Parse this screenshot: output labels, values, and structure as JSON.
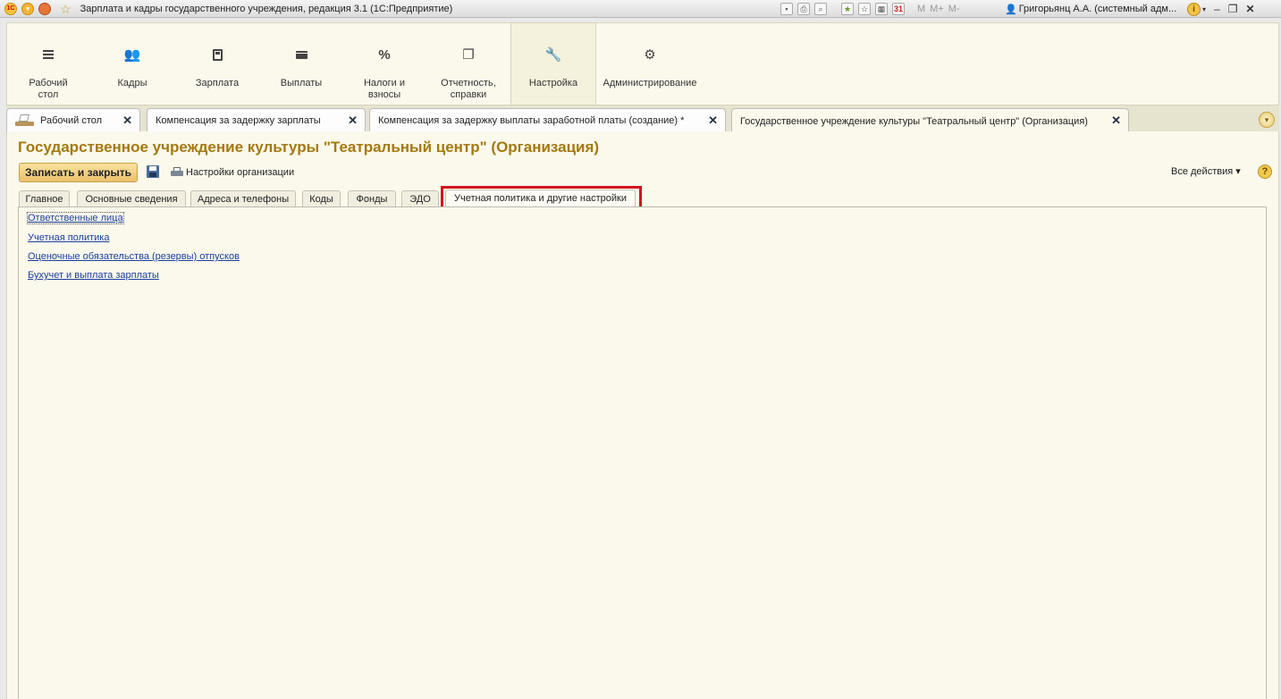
{
  "window": {
    "title": "Зарплата и кадры государственного учреждения, редакция 3.1  (1С:Предприятие)",
    "user": "Григорьянц А.А. (системный адм...",
    "memory_buttons": [
      "M",
      "M+",
      "M-"
    ],
    "calendar_day": "31",
    "icons": [
      "1c-logo-icon",
      "main-menu-icon",
      "history-icon",
      "favorites-star-icon",
      "save-icon",
      "print-icon",
      "preview-icon",
      "add-favorite-icon",
      "favorites-icon",
      "calculator-icon",
      "calendar-icon",
      "user-icon",
      "info-icon",
      "minimize-icon",
      "restore-icon",
      "close-icon"
    ]
  },
  "sections": [
    {
      "label": "Рабочий\nстол",
      "icon": "menu-lines-icon"
    },
    {
      "label": "Кадры",
      "icon": "people-icon"
    },
    {
      "label": "Зарплата",
      "icon": "calculator-icon"
    },
    {
      "label": "Выплаты",
      "icon": "wallet-icon"
    },
    {
      "label": "Налоги и\nвзносы",
      "icon": "percent-icon"
    },
    {
      "label": "Отчетность,\nсправки",
      "icon": "documents-icon"
    },
    {
      "label": "Настройка",
      "icon": "wrench-icon",
      "active": true
    },
    {
      "label": "Администрирование",
      "icon": "gear-icon"
    }
  ],
  "open_tabs": [
    {
      "label": "Рабочий стол"
    },
    {
      "label": "Компенсация за задержку зарплаты"
    },
    {
      "label": "Компенсация за задержку выплаты заработной платы (создание) *"
    },
    {
      "label": "Государственное учреждение культуры \"Театральный центр\" (Организация)",
      "active": true
    }
  ],
  "form": {
    "title": "Государственное учреждение культуры \"Театральный центр\" (Организация)",
    "save_close_label": "Записать и закрыть",
    "org_settings_label": "Настройки организации",
    "all_actions_label": "Все действия ▾",
    "help_label": "?",
    "tabs": [
      {
        "label": "Главное"
      },
      {
        "label": "Основные сведения"
      },
      {
        "label": "Адреса и телефоны"
      },
      {
        "label": "Коды"
      },
      {
        "label": "Фонды"
      },
      {
        "label": "ЭДО"
      },
      {
        "label": "Учетная политика и другие настройки",
        "active": true,
        "highlighted": true
      }
    ],
    "links": [
      {
        "label": "Ответственные лица"
      },
      {
        "label": "Учетная политика"
      },
      {
        "label": "Оценочные обязательства (резервы) отпусков"
      },
      {
        "label": "Бухучет и выплата зарплаты"
      }
    ]
  },
  "colors": {
    "accent_title": "#a4790e",
    "panel_bg": "#fbf9ec",
    "link": "#1b3f9e",
    "highlight_box": "#d5121f",
    "primary_button": "#eac06a"
  }
}
